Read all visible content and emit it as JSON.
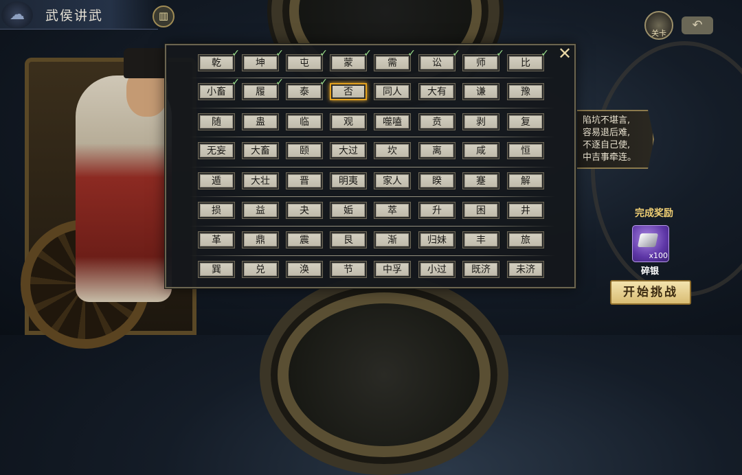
{
  "header": {
    "title": "武侯讲武",
    "emblem_icon": "cloud-emblem-icon",
    "book_icon": "book-icon"
  },
  "top_right": {
    "guan_label": "关卡",
    "back_icon": "back-arrow-icon"
  },
  "poem": {
    "lines": [
      "陷坑不堪言,",
      "容易退后难,",
      "不逐自己使,",
      "中吉事牵连。"
    ]
  },
  "reward": {
    "title": "完成奖励",
    "item_name": "碎银",
    "item_count": "x100",
    "item_icon": "silver-ingot-icon"
  },
  "start_button": "开始挑战",
  "dialog": {
    "close_icon": "close-icon",
    "selected": "否",
    "rows": [
      [
        {
          "name": "乾",
          "done": true
        },
        {
          "name": "坤",
          "done": true
        },
        {
          "name": "屯",
          "done": true
        },
        {
          "name": "蒙",
          "done": true
        },
        {
          "name": "需",
          "done": true
        },
        {
          "name": "讼",
          "done": true
        },
        {
          "name": "师",
          "done": true
        },
        {
          "name": "比",
          "done": true
        }
      ],
      [
        {
          "name": "小畜",
          "done": true
        },
        {
          "name": "履",
          "done": true
        },
        {
          "name": "泰",
          "done": true
        },
        {
          "name": "否",
          "done": false
        },
        {
          "name": "同人",
          "done": false
        },
        {
          "name": "大有",
          "done": false
        },
        {
          "name": "谦",
          "done": false
        },
        {
          "name": "豫",
          "done": false
        }
      ],
      [
        {
          "name": "随",
          "done": false
        },
        {
          "name": "蛊",
          "done": false
        },
        {
          "name": "临",
          "done": false
        },
        {
          "name": "观",
          "done": false
        },
        {
          "name": "噬嗑",
          "done": false
        },
        {
          "name": "贲",
          "done": false
        },
        {
          "name": "剥",
          "done": false
        },
        {
          "name": "复",
          "done": false
        }
      ],
      [
        {
          "name": "无妄",
          "done": false
        },
        {
          "name": "大畜",
          "done": false
        },
        {
          "name": "颐",
          "done": false
        },
        {
          "name": "大过",
          "done": false
        },
        {
          "name": "坎",
          "done": false
        },
        {
          "name": "离",
          "done": false
        },
        {
          "name": "咸",
          "done": false
        },
        {
          "name": "恒",
          "done": false
        }
      ],
      [
        {
          "name": "遁",
          "done": false
        },
        {
          "name": "大壮",
          "done": false
        },
        {
          "name": "晋",
          "done": false
        },
        {
          "name": "明夷",
          "done": false
        },
        {
          "name": "家人",
          "done": false
        },
        {
          "name": "睽",
          "done": false
        },
        {
          "name": "蹇",
          "done": false
        },
        {
          "name": "解",
          "done": false
        }
      ],
      [
        {
          "name": "损",
          "done": false
        },
        {
          "name": "益",
          "done": false
        },
        {
          "name": "夬",
          "done": false
        },
        {
          "name": "姤",
          "done": false
        },
        {
          "name": "萃",
          "done": false
        },
        {
          "name": "升",
          "done": false
        },
        {
          "name": "困",
          "done": false
        },
        {
          "name": "井",
          "done": false
        }
      ],
      [
        {
          "name": "革",
          "done": false
        },
        {
          "name": "鼎",
          "done": false
        },
        {
          "name": "震",
          "done": false
        },
        {
          "name": "艮",
          "done": false
        },
        {
          "name": "渐",
          "done": false
        },
        {
          "name": "归妹",
          "done": false
        },
        {
          "name": "丰",
          "done": false
        },
        {
          "name": "旅",
          "done": false
        }
      ],
      [
        {
          "name": "巽",
          "done": false
        },
        {
          "name": "兑",
          "done": false
        },
        {
          "name": "涣",
          "done": false
        },
        {
          "name": "节",
          "done": false
        },
        {
          "name": "中孚",
          "done": false
        },
        {
          "name": "小过",
          "done": false
        },
        {
          "name": "既济",
          "done": false
        },
        {
          "name": "未济",
          "done": false
        }
      ]
    ]
  },
  "colors": {
    "selected_border": "#e4a21f",
    "check_mark": "#9ae08c",
    "reward_title": "#f0cf74",
    "reward_bg": "#5d36a6"
  }
}
